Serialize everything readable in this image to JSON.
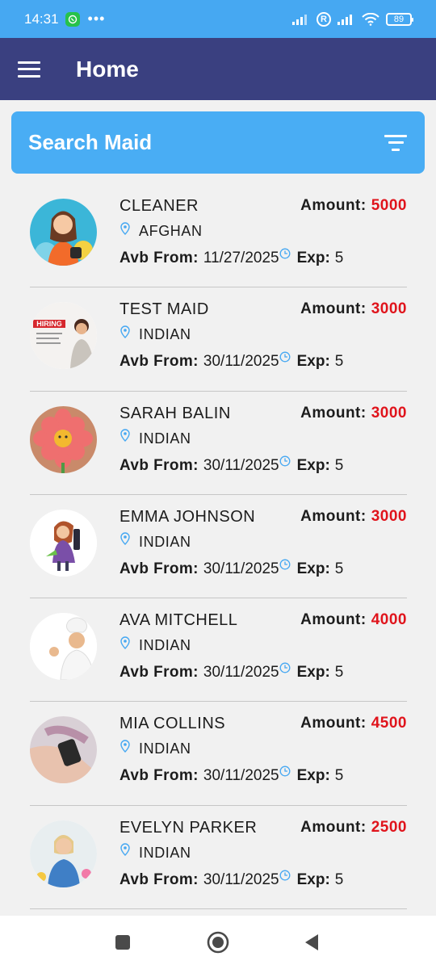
{
  "status_bar": {
    "time": "14:31",
    "dots": "•••",
    "roaming": "R",
    "battery": "89"
  },
  "app_bar": {
    "title": "Home"
  },
  "search": {
    "label": "Search Maid"
  },
  "labels": {
    "amount": "Amount:",
    "avb_from": "Avb From:",
    "exp": "Exp:"
  },
  "maids": [
    {
      "name": "CLEANER",
      "amount": "5000",
      "country": "AFGHAN",
      "available_from": "11/27/2025",
      "exp": "5"
    },
    {
      "name": "TEST MAID",
      "amount": "3000",
      "country": "INDIAN",
      "available_from": "30/11/2025",
      "exp": "5"
    },
    {
      "name": "SARAH BALIN",
      "amount": "3000",
      "country": "INDIAN",
      "available_from": "30/11/2025",
      "exp": "5"
    },
    {
      "name": "EMMA JOHNSON",
      "amount": "3000",
      "country": "INDIAN",
      "available_from": "30/11/2025",
      "exp": "5"
    },
    {
      "name": "AVA MITCHELL",
      "amount": "4000",
      "country": "INDIAN",
      "available_from": "30/11/2025",
      "exp": "5"
    },
    {
      "name": "MIA COLLINS",
      "amount": "4500",
      "country": "INDIAN",
      "available_from": "30/11/2025",
      "exp": "5"
    },
    {
      "name": "EVELYN PARKER",
      "amount": "2500",
      "country": "INDIAN",
      "available_from": "30/11/2025",
      "exp": "5"
    }
  ],
  "avatar_hiring_text": "HIRING",
  "colors": {
    "status_bar": "#46a8f2",
    "app_bar": "#3a4080",
    "search": "#49adf4",
    "amount": "#e0141c",
    "pin": "#46a8f2"
  }
}
